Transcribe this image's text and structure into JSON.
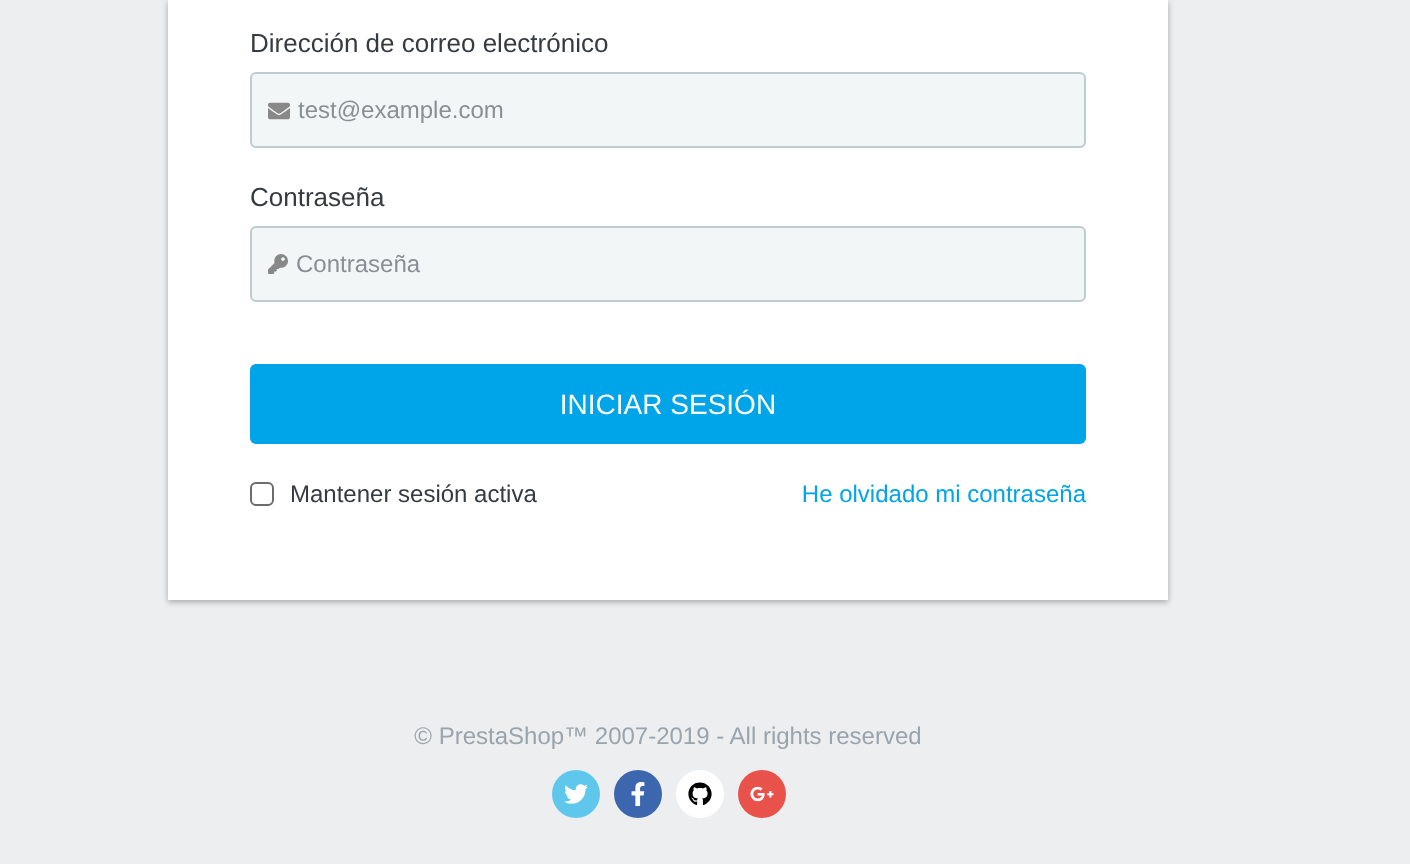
{
  "form": {
    "email": {
      "label": "Dirección de correo electrónico",
      "placeholder": "test@example.com"
    },
    "password": {
      "label": "Contraseña",
      "placeholder": "Contraseña"
    },
    "submit": "INICIAR SESIÓN",
    "remember": {
      "label": "Mantener sesión activa",
      "checked": false
    },
    "forgot_link": "He olvidado mi contraseña"
  },
  "footer": {
    "copyright": "© PrestaShop™ 2007-2019 - All rights reserved",
    "social": [
      {
        "kind": "twitter",
        "color": "#5fc6ec"
      },
      {
        "kind": "facebook",
        "color": "#3c66ad"
      },
      {
        "kind": "github",
        "color": "#ffffff"
      },
      {
        "kind": "googleplus",
        "color": "#e9524a"
      }
    ]
  }
}
